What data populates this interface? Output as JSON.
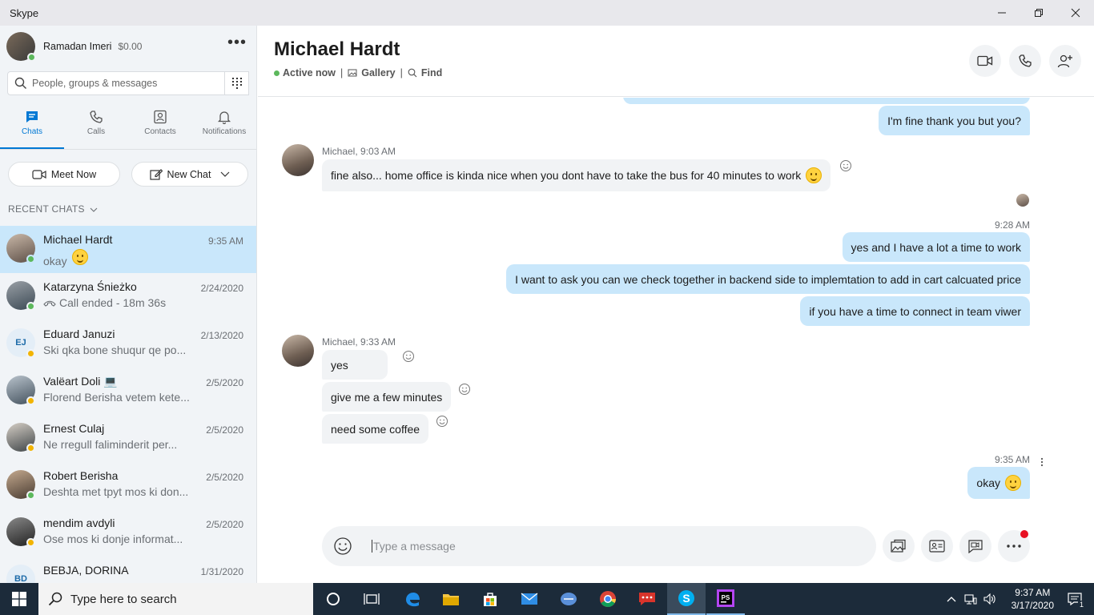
{
  "window": {
    "title": "Skype"
  },
  "profile": {
    "name": "Ramadan Imeri",
    "credit": "$0.00"
  },
  "search": {
    "placeholder": "People, groups & messages"
  },
  "nav": [
    {
      "label": "Chats"
    },
    {
      "label": "Calls"
    },
    {
      "label": "Contacts"
    },
    {
      "label": "Notifications"
    }
  ],
  "actions": {
    "meet_now": "Meet Now",
    "new_chat": "New Chat"
  },
  "recent_label": "RECENT CHATS",
  "chats": [
    {
      "name": "Michael Hardt",
      "date": "9:35 AM",
      "preview": "okay",
      "status_color": "#5cb85c"
    },
    {
      "name": "Katarzyna Śnieżko",
      "date": "2/24/2020",
      "preview": "Call ended - 18m 36s",
      "status_color": "#5cb85c"
    },
    {
      "name": "Eduard Januzi",
      "initials": "EJ",
      "date": "2/13/2020",
      "preview": "Ski qka bone shuqur qe po...",
      "status_color": "#f2b400"
    },
    {
      "name": "Valëart Doli 💻",
      "date": "2/5/2020",
      "preview": "Florend Berisha vetem kete...",
      "status_color": "#f2b400"
    },
    {
      "name": "Ernest Culaj",
      "date": "2/5/2020",
      "preview": "Ne rregull faliminderit per...",
      "status_color": "#f2b400"
    },
    {
      "name": "Robert Berisha",
      "date": "2/5/2020",
      "preview": "Deshta met tpyt mos ki don...",
      "status_color": "#5cb85c"
    },
    {
      "name": "mendim avdyli",
      "date": "2/5/2020",
      "preview": "Ose mos ki donje informat...",
      "status_color": "#f2b400"
    },
    {
      "name": "BEBJA, DORINA",
      "initials": "BD",
      "date": "1/31/2020",
      "preview": "",
      "status_color": "#f2b400"
    }
  ],
  "conversation": {
    "contact": "Michael Hardt",
    "status": "Active now",
    "gallery": "Gallery",
    "find": "Find",
    "messages": {
      "out_1": "I'm fine thank you but you?",
      "sender_1": "Michael, 9:03 AM",
      "in_1": "fine also... home office is kinda nice when you dont have to take the bus for 40 minutes to work",
      "ts_1": "9:28 AM",
      "out_2": "yes and I have a lot a time to work",
      "out_3": "I want to ask you can we check together in backend side to implemtation to add in cart calcuated price",
      "out_4": "if you have a time to connect in team viwer",
      "sender_2": "Michael, 9:33 AM",
      "in_2": "yes",
      "in_3": "give me a few minutes",
      "in_4": "need some coffee",
      "ts_2": "9:35 AM",
      "out_5": "okay"
    },
    "composer_placeholder": "Type a message"
  },
  "taskbar": {
    "search_placeholder": "Type here to search",
    "time": "9:37 AM",
    "date": "3/17/2020",
    "notif_count": "1"
  },
  "colors": {
    "accent": "#0078d4",
    "bubble_out": "#c9e7fb",
    "bubble_in": "#f1f3f5",
    "online": "#5cb85c",
    "away": "#f2b400",
    "notification_dot": "#e81123"
  }
}
